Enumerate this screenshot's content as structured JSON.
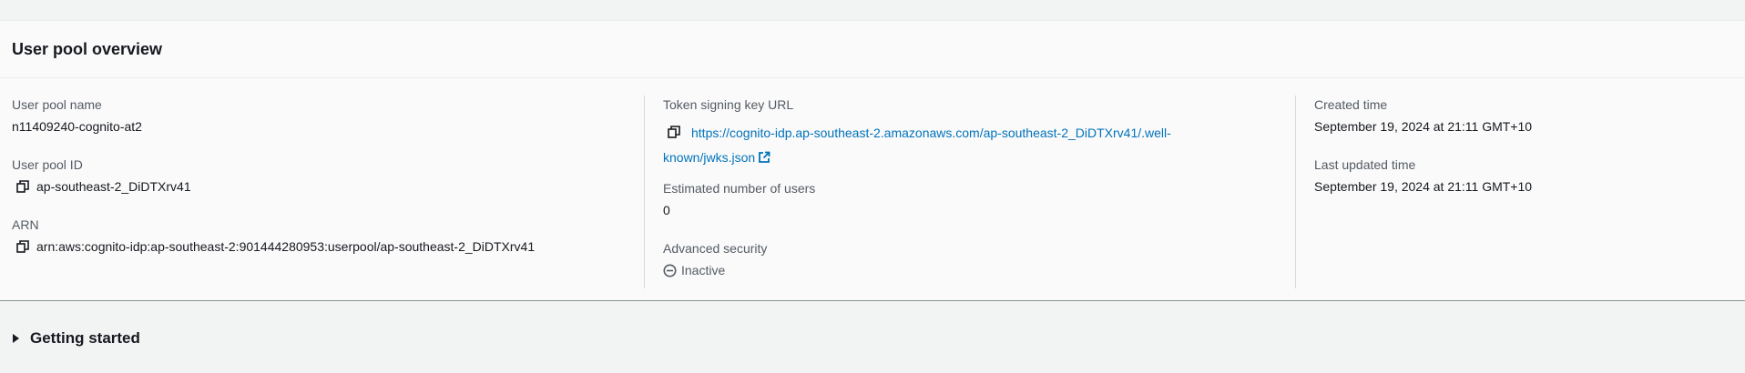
{
  "overview": {
    "title": "User pool overview",
    "user_pool_name": {
      "label": "User pool name",
      "value": "n11409240-cognito-at2"
    },
    "user_pool_id": {
      "label": "User pool ID",
      "value": "ap-southeast-2_DiDTXrv41"
    },
    "arn": {
      "label": "ARN",
      "value": "arn:aws:cognito-idp:ap-southeast-2:901444280953:userpool/ap-southeast-2_DiDTXrv41"
    },
    "token_signing_key_url": {
      "label": "Token signing key URL",
      "value": "https://cognito-idp.ap-southeast-2.amazonaws.com/ap-southeast-2_DiDTXrv41/.well-known/jwks.json",
      "line1": "https://cognito-idp.ap-southeast-2.amazonaws.com/ap-southeast-2_DiDTXrv41/.well-",
      "line2": "known/jwks.json"
    },
    "estimated_users": {
      "label": "Estimated number of users",
      "value": "0"
    },
    "advanced_security": {
      "label": "Advanced security",
      "value": "Inactive"
    },
    "created_time": {
      "label": "Created time",
      "value": "September 19, 2024 at 21:11 GMT+10"
    },
    "last_updated_time": {
      "label": "Last updated time",
      "value": "September 19, 2024 at 21:11 GMT+10"
    }
  },
  "getting_started": {
    "title": "Getting started"
  },
  "colors": {
    "link": "#0073bb",
    "label": "#545b64",
    "text": "#16191f",
    "panel_bg": "#fafafa",
    "page_bg": "#f2f3f3"
  },
  "icons": {
    "copy": "copy-icon",
    "external": "external-link-icon",
    "status_inactive": "inactive-status-icon",
    "expand": "caret-right-icon"
  }
}
